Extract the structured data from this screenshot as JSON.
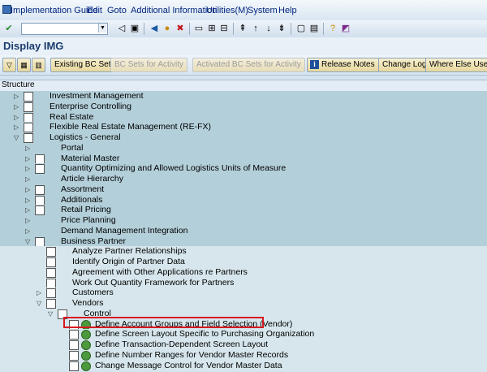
{
  "menu": [
    "Implementation Guide",
    "Edit",
    "Goto",
    "Additional Information",
    "Utilities(M)",
    "System",
    "Help"
  ],
  "title": "Display IMG",
  "app_toolbar": {
    "existing_bc_sets": "Existing BC Sets",
    "bc_sets_for_activity": "BC Sets for Activity",
    "activated_bc_sets": "Activated BC Sets for Activity",
    "release_notes": "Release Notes",
    "change_log": "Change Log",
    "where_else_used": "Where Else Used"
  },
  "structure_header": "Structure",
  "highlighted_item": "Define Account Groups and Field Selection (Vendor)",
  "tree": [
    {
      "label": "Investment Management",
      "level": 0,
      "expand": "collapsed",
      "icon": "doc",
      "shade": "dark"
    },
    {
      "label": "Enterprise Controlling",
      "level": 0,
      "expand": "collapsed",
      "icon": "doc",
      "shade": "dark"
    },
    {
      "label": "Real Estate",
      "level": 0,
      "expand": "collapsed",
      "icon": "doc",
      "shade": "dark"
    },
    {
      "label": "Flexible Real Estate Management (RE-FX)",
      "level": 0,
      "expand": "collapsed",
      "icon": "doc",
      "shade": "dark"
    },
    {
      "label": "Logistics - General",
      "level": 0,
      "expand": "expanded",
      "icon": "doc",
      "shade": "dark"
    },
    {
      "label": "Portal",
      "level": 1,
      "expand": "collapsed",
      "icon": "none",
      "shade": "dark"
    },
    {
      "label": "Material Master",
      "level": 1,
      "expand": "collapsed",
      "icon": "doc",
      "shade": "dark"
    },
    {
      "label": "Quantity Optimizing and Allowed Logistics Units of Measure",
      "level": 1,
      "expand": "collapsed",
      "icon": "doc",
      "shade": "dark"
    },
    {
      "label": "Article Hierarchy",
      "level": 1,
      "expand": "collapsed",
      "icon": "none",
      "shade": "dark"
    },
    {
      "label": "Assortment",
      "level": 1,
      "expand": "collapsed",
      "icon": "doc",
      "shade": "dark"
    },
    {
      "label": "Additionals",
      "level": 1,
      "expand": "collapsed",
      "icon": "doc",
      "shade": "dark"
    },
    {
      "label": "Retail Pricing",
      "level": 1,
      "expand": "collapsed",
      "icon": "doc",
      "shade": "dark"
    },
    {
      "label": "Price Planning",
      "level": 1,
      "expand": "collapsed",
      "icon": "none",
      "shade": "dark"
    },
    {
      "label": "Demand Management Integration",
      "level": 1,
      "expand": "collapsed",
      "icon": "none",
      "shade": "dark"
    },
    {
      "label": "Business Partner",
      "level": 1,
      "expand": "expanded",
      "icon": "doc",
      "shade": "dark"
    },
    {
      "label": "Analyze Partner Relationships",
      "level": 2,
      "expand": "none",
      "icon": "doc",
      "shade": "light"
    },
    {
      "label": "Identify Origin of Partner Data",
      "level": 2,
      "expand": "none",
      "icon": "doc",
      "shade": "light"
    },
    {
      "label": "Agreement with Other Applications re Partners",
      "level": 2,
      "expand": "none",
      "icon": "doc",
      "shade": "light"
    },
    {
      "label": "Work Out Quantity Framework for Partners",
      "level": 2,
      "expand": "none",
      "icon": "doc",
      "shade": "light"
    },
    {
      "label": "Customers",
      "level": 2,
      "expand": "collapsed",
      "icon": "doc",
      "shade": "light"
    },
    {
      "label": "Vendors",
      "level": 2,
      "expand": "expanded",
      "icon": "doc",
      "shade": "light"
    },
    {
      "label": "Control",
      "level": 3,
      "expand": "expanded",
      "icon": "doc",
      "shade": "light"
    },
    {
      "label": "Define Account Groups and Field Selection (Vendor)",
      "level": 4,
      "expand": "none",
      "icon": "exec",
      "shade": "light"
    },
    {
      "label": "Define Screen Layout Specific to Purchasing Organization",
      "level": 4,
      "expand": "none",
      "icon": "exec",
      "shade": "light"
    },
    {
      "label": "Define Transaction-Dependent Screen Layout",
      "level": 4,
      "expand": "none",
      "icon": "exec",
      "shade": "light"
    },
    {
      "label": "Define Number Ranges for Vendor Master Records",
      "level": 4,
      "expand": "none",
      "icon": "exec",
      "shade": "light"
    },
    {
      "label": "Change Message Control for Vendor Master Data",
      "level": 4,
      "expand": "none",
      "icon": "exec",
      "shade": "light"
    }
  ]
}
